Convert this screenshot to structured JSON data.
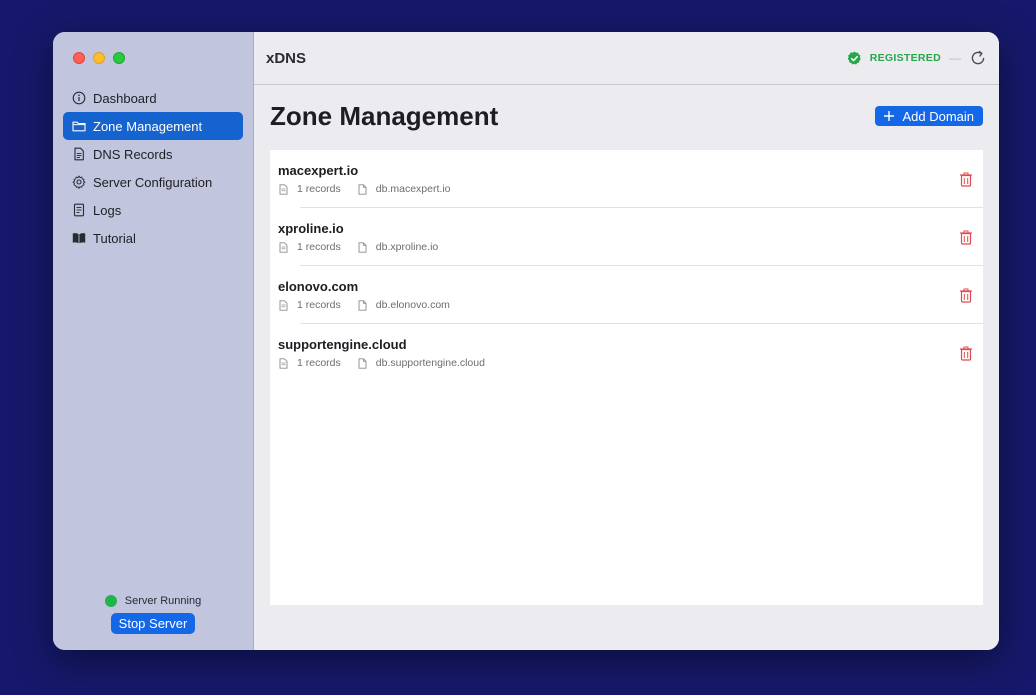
{
  "app": {
    "title": "xDNS",
    "registration_status": "REGISTERED",
    "registration_separator": "—",
    "colors": {
      "accent": "#1467e6",
      "success": "#22b34a",
      "danger": "#e5484d",
      "sidebar": "#c1c6de"
    }
  },
  "sidebar": {
    "items": [
      {
        "label": "Dashboard",
        "icon": "info-circle-icon",
        "active": false
      },
      {
        "label": "Zone Management",
        "icon": "folder-icon",
        "active": true
      },
      {
        "label": "DNS Records",
        "icon": "document-icon",
        "active": false
      },
      {
        "label": "Server Configuration",
        "icon": "gear-icon",
        "active": false
      },
      {
        "label": "Logs",
        "icon": "log-icon",
        "active": false
      },
      {
        "label": "Tutorial",
        "icon": "book-icon",
        "active": false
      }
    ],
    "server_status": "Server Running",
    "stop_button": "Stop Server"
  },
  "main": {
    "title": "Zone Management",
    "add_button": "Add Domain",
    "zones": [
      {
        "name": "macexpert.io",
        "records": "1 records",
        "file": "db.macexpert.io"
      },
      {
        "name": "xproline.io",
        "records": "1 records",
        "file": "db.xproline.io"
      },
      {
        "name": "elonovo.com",
        "records": "1 records",
        "file": "db.elonovo.com"
      },
      {
        "name": "supportengine.cloud",
        "records": "1 records",
        "file": "db.supportengine.cloud"
      }
    ]
  }
}
